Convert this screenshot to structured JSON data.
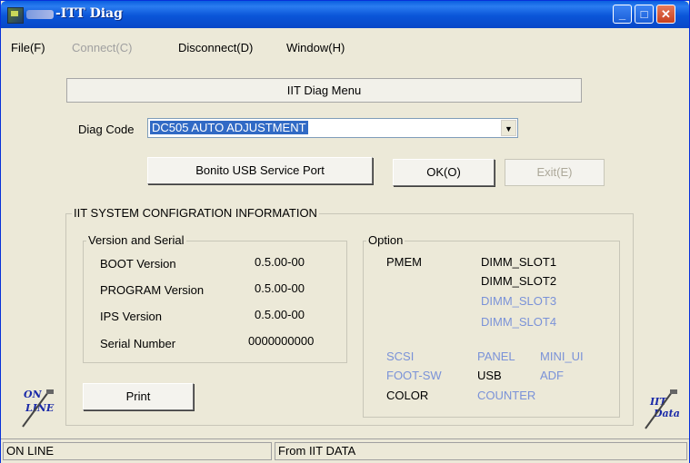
{
  "window": {
    "title": "-ITT Diag"
  },
  "menubar": {
    "items": [
      {
        "label": "File(F)",
        "disabled": false
      },
      {
        "label": "Connect(C)",
        "disabled": true
      },
      {
        "label": "Disconnect(D)",
        "disabled": false
      },
      {
        "label": "Window(H)",
        "disabled": false
      }
    ]
  },
  "header_button": "IIT Diag Menu",
  "diag_code": {
    "label": "Diag Code",
    "value": "DC505 AUTO ADJUSTMENT"
  },
  "buttons": {
    "bonito": "Bonito USB Service Port",
    "ok": "OK(O)",
    "exit": "Exit(E)",
    "print": "Print"
  },
  "config": {
    "title": "IIT SYSTEM CONFIGRATION INFORMATION",
    "version": {
      "title": "Version and Serial",
      "rows": [
        {
          "label": "BOOT Version",
          "value": "0.5.00-00"
        },
        {
          "label": "PROGRAM Version",
          "value": "0.5.00-00"
        },
        {
          "label": "IPS Version",
          "value": "0.5.00-00"
        },
        {
          "label": "Serial Number",
          "value": "0000000000"
        }
      ]
    },
    "option": {
      "title": "Option",
      "pmem": "PMEM",
      "dimm": [
        {
          "label": "DIMM_SLOT1",
          "active": true
        },
        {
          "label": "DIMM_SLOT2",
          "active": true
        },
        {
          "label": "DIMM_SLOT3",
          "active": false
        },
        {
          "label": "DIMM_SLOT4",
          "active": false
        }
      ],
      "flags": {
        "scsi": "SCSI",
        "panel": "PANEL",
        "mini_ui": "MINI_UI",
        "foot_sw": "FOOT-SW",
        "usb": "USB",
        "adf": "ADF",
        "color": "COLOR",
        "counter": "COUNTER"
      }
    }
  },
  "side_icons": {
    "online": "ON LINE",
    "iit_data": "IIT Data"
  },
  "status": {
    "left": "ON LINE",
    "right": "From IIT DATA"
  },
  "colors": {
    "titlebar": "#0a55d8",
    "selection": "#316ac5",
    "disabled_option": "#7a92d8"
  }
}
